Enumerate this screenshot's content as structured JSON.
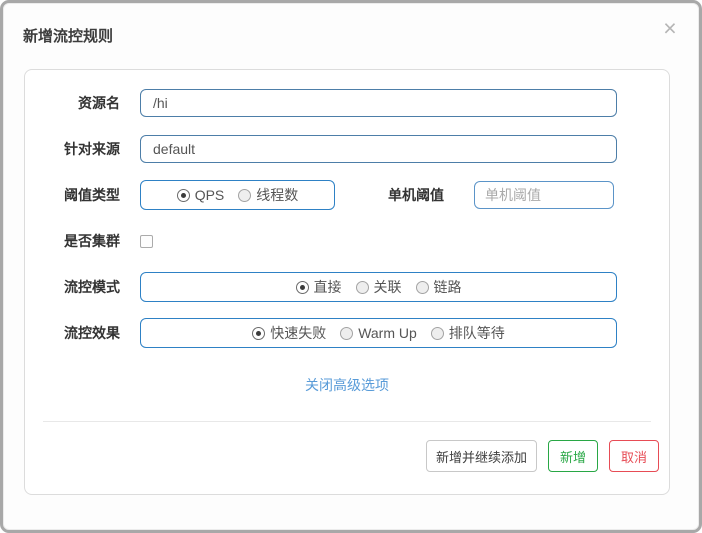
{
  "dialog": {
    "title": "新增流控规则",
    "close_icon": "×"
  },
  "form": {
    "resource": {
      "label": "资源名",
      "value": "/hi"
    },
    "limit_app": {
      "label": "针对来源",
      "value": "default"
    },
    "grade": {
      "label": "阈值类型",
      "options": [
        {
          "label": "QPS",
          "selected": true
        },
        {
          "label": "线程数",
          "selected": false
        }
      ]
    },
    "threshold": {
      "label": "单机阈值",
      "placeholder": "单机阈值",
      "value": ""
    },
    "cluster": {
      "label": "是否集群",
      "checked": false
    },
    "strategy": {
      "label": "流控模式",
      "options": [
        {
          "label": "直接",
          "selected": true
        },
        {
          "label": "关联",
          "selected": false
        },
        {
          "label": "链路",
          "selected": false
        }
      ]
    },
    "behavior": {
      "label": "流控效果",
      "options": [
        {
          "label": "快速失败",
          "selected": true
        },
        {
          "label": "Warm Up",
          "selected": false
        },
        {
          "label": "排队等待",
          "selected": false
        }
      ]
    },
    "advanced_link": "关闭高级选项"
  },
  "footer": {
    "add_continue_label": "新增并继续添加",
    "add_label": "新增",
    "cancel_label": "取消"
  },
  "colors": {
    "input_border": "#4d7ea8",
    "radio_group_border": "#2e81c5",
    "link_blue": "#589bd8",
    "success_green": "#28a745",
    "danger_red": "#e74c55",
    "window_border": "#a8a8a8"
  }
}
